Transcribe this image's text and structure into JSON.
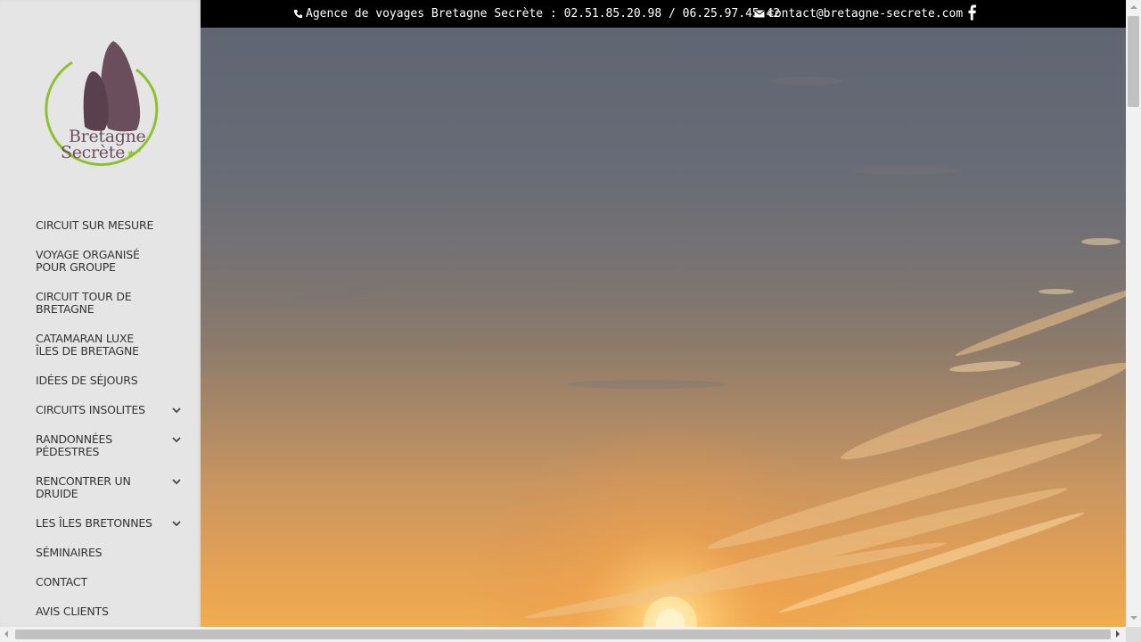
{
  "brand": {
    "name_line1": "Bretagne",
    "name_line2": "Secrète",
    "colors": {
      "stone": "#6b4e5c",
      "ring": "#8cc22f"
    }
  },
  "topbar": {
    "phone_icon": "phone-icon",
    "phone_text": "Agence de voyages Bretagne Secrète : 02.51.85.20.98 / 06.25.97.45.42",
    "email_icon": "envelope-icon",
    "email_text": "contact@bretagne-secrete.com",
    "social_icon": "facebook-icon"
  },
  "nav": {
    "items": [
      {
        "label": "CIRCUIT SUR MESURE",
        "has_submenu": false
      },
      {
        "label": "VOYAGE ORGANISÉ POUR GROUPE",
        "has_submenu": false
      },
      {
        "label": "CIRCUIT TOUR DE BRETAGNE",
        "has_submenu": false
      },
      {
        "label": "CATAMARAN LUXE ÎLES DE BRETAGNE",
        "has_submenu": false
      },
      {
        "label": "IDÉES DE SÉJOURS",
        "has_submenu": false
      },
      {
        "label": "CIRCUITS INSOLITES",
        "has_submenu": true
      },
      {
        "label": "RANDONNÉES PÉDESTRES",
        "has_submenu": true
      },
      {
        "label": "RENCONTRER UN DRUIDE",
        "has_submenu": true
      },
      {
        "label": "LES ÎLES BRETONNES",
        "has_submenu": true
      },
      {
        "label": "SÉMINAIRES",
        "has_submenu": false
      },
      {
        "label": "CONTACT",
        "has_submenu": false
      },
      {
        "label": "AVIS CLIENTS",
        "has_submenu": false
      }
    ]
  },
  "colors": {
    "sidebar_bg": "#e5e5e5",
    "nav_text": "#333333",
    "topbar_bg": "#000000",
    "topbar_text": "#ffffff"
  }
}
